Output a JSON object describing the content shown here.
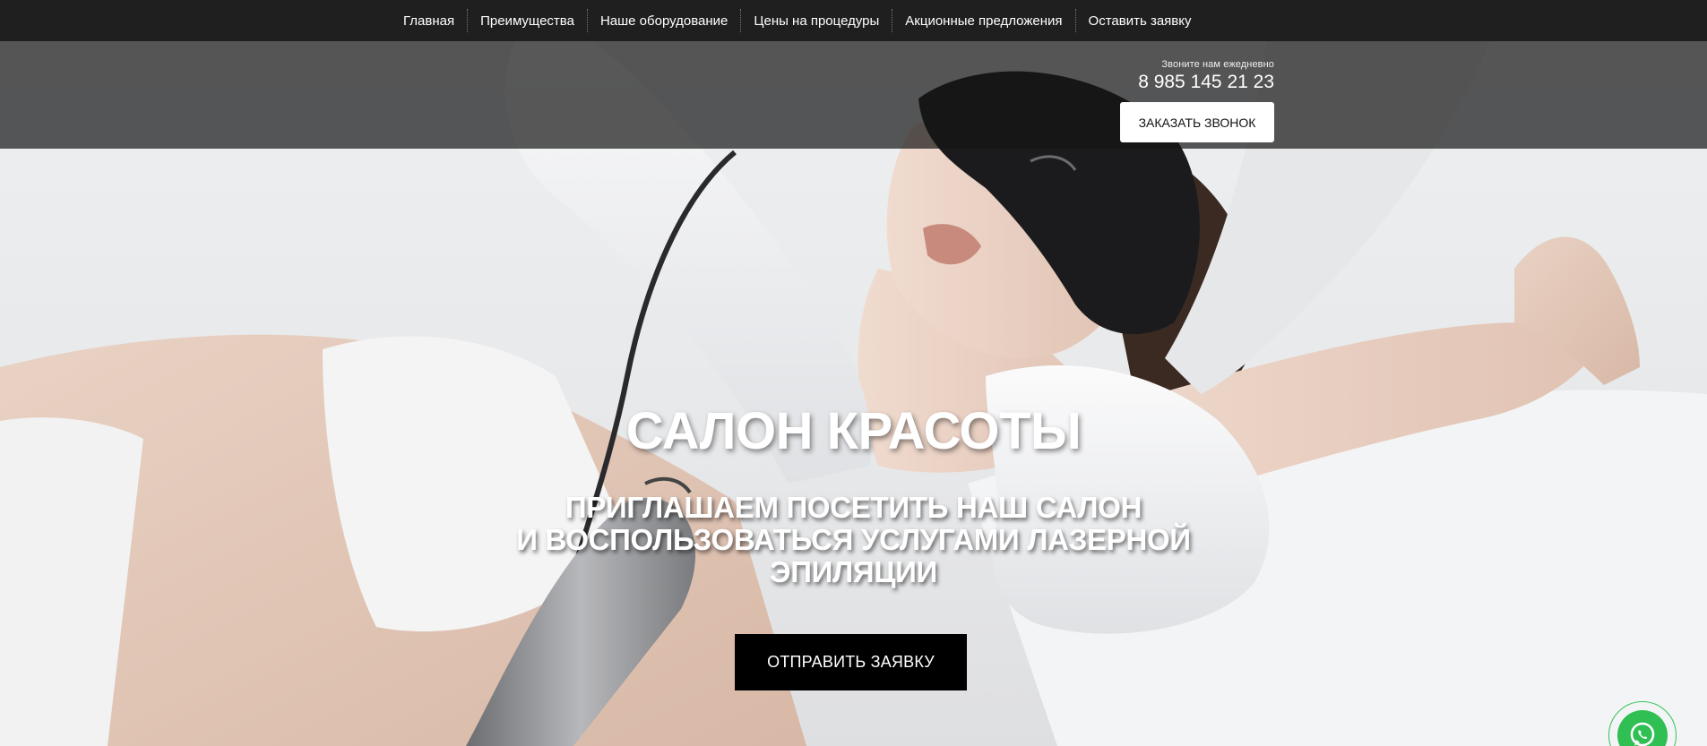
{
  "nav": {
    "items": [
      {
        "label": "Главная"
      },
      {
        "label": "Преимущества"
      },
      {
        "label": "Наше оборудование"
      },
      {
        "label": "Цены на процедуры"
      },
      {
        "label": "Акционные предложения"
      },
      {
        "label": "Оставить заявку"
      }
    ]
  },
  "header": {
    "call_note": "Звоните нам ежедневно",
    "phone": "8 985 145 21 23",
    "callback_label": "ЗАКАЗАТЬ ЗВОНОК"
  },
  "hero": {
    "title": "САЛОН КРАСОТЫ",
    "subtitle_lines": [
      "ПРИГЛАШАЕМ ПОСЕТИТЬ НАШ САЛОН",
      "И ВОСПОЛЬЗОВАТЬСЯ УСЛУГАМИ ЛАЗЕРНОЙ",
      "ЭПИЛЯЦИИ"
    ],
    "submit_label": "ОТПРАВИТЬ ЗАЯВКУ"
  },
  "whatsapp": {
    "icon": "whatsapp-icon",
    "color": "#2fbf52"
  },
  "colors": {
    "nav_bg": "#1f1f1f",
    "button_dark": "#000000",
    "button_light": "#ffffff"
  }
}
